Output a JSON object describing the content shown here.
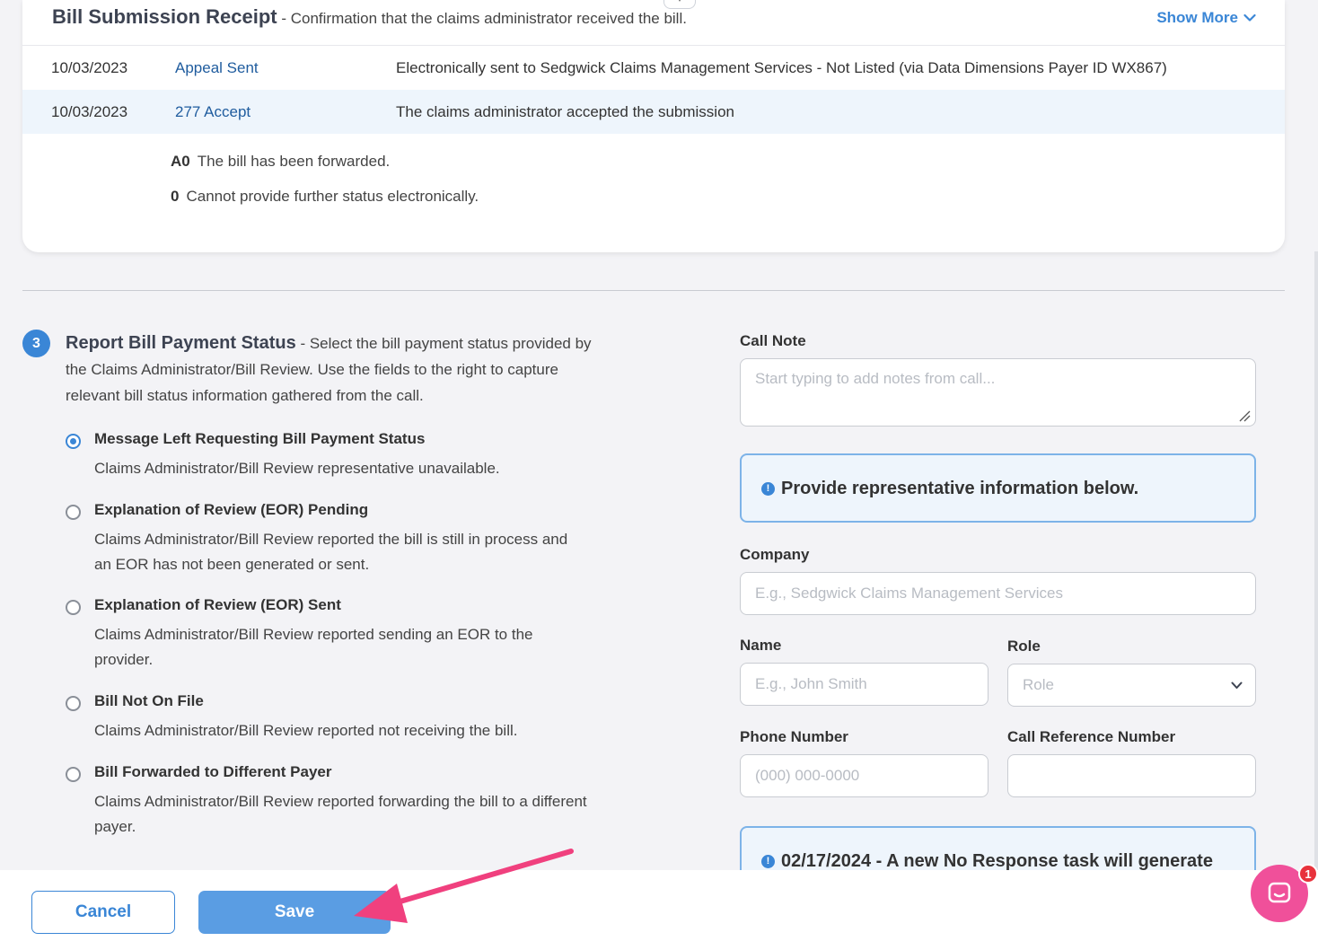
{
  "receipt": {
    "title": "Bill Submission Receipt",
    "subtitle": " - Confirmation that the claims administrator received the bill.",
    "show_more": "Show More",
    "rows": [
      {
        "date": "10/03/2023",
        "status": "Appeal Sent",
        "desc": "Electronically sent to Sedgwick Claims Management Services - Not Listed (via Data Dimensions Payer ID WX867)"
      },
      {
        "date": "10/03/2023",
        "status": "277 Accept",
        "desc": "The claims administrator accepted the submission"
      }
    ],
    "codes": [
      {
        "code": "A0",
        "text": "The bill has been forwarded."
      },
      {
        "code": "0",
        "text": "Cannot provide further status electronically."
      }
    ]
  },
  "step": {
    "number": "3",
    "title": "Report Bill Payment Status",
    "description": " - Select the bill payment status provided by the Claims Administrator/Bill Review. Use the fields to the right to capture relevant bill status information gathered from the call."
  },
  "options": [
    {
      "label": "Message Left Requesting Bill Payment Status",
      "desc": "Claims Administrator/Bill Review representative unavailable.",
      "selected": true
    },
    {
      "label": "Explanation of Review (EOR) Pending",
      "desc": "Claims Administrator/Bill Review reported the bill is still in process and an EOR has not been generated or sent.",
      "selected": false
    },
    {
      "label": "Explanation of Review (EOR) Sent",
      "desc": "Claims Administrator/Bill Review reported sending an EOR to the provider.",
      "selected": false
    },
    {
      "label": "Bill Not On File",
      "desc": "Claims Administrator/Bill Review reported not receiving the bill.",
      "selected": false
    },
    {
      "label": "Bill Forwarded to Different Payer",
      "desc": "Claims Administrator/Bill Review reported forwarding the bill to a different payer.",
      "selected": false
    }
  ],
  "form": {
    "call_note_label": "Call Note",
    "call_note_placeholder": "Start typing to add notes from call...",
    "info_message": "Provide representative information below.",
    "company_label": "Company",
    "company_placeholder": "E.g., Sedgwick Claims Management Services",
    "name_label": "Name",
    "name_placeholder": "E.g., John Smith",
    "role_label": "Role",
    "role_placeholder": "Role",
    "phone_label": "Phone Number",
    "phone_placeholder": "(000) 000-0000",
    "call_ref_label": "Call Reference Number",
    "call_ref_value": "",
    "task_notice": "02/17/2024 - A new No Response task will generate"
  },
  "footer": {
    "cancel_label": "Cancel",
    "save_label": "Save"
  },
  "chat": {
    "badge_count": "1"
  },
  "colors": {
    "accent": "#3a86d6",
    "chat": "#f0509a",
    "annotation_arrow": "#f0407e"
  }
}
